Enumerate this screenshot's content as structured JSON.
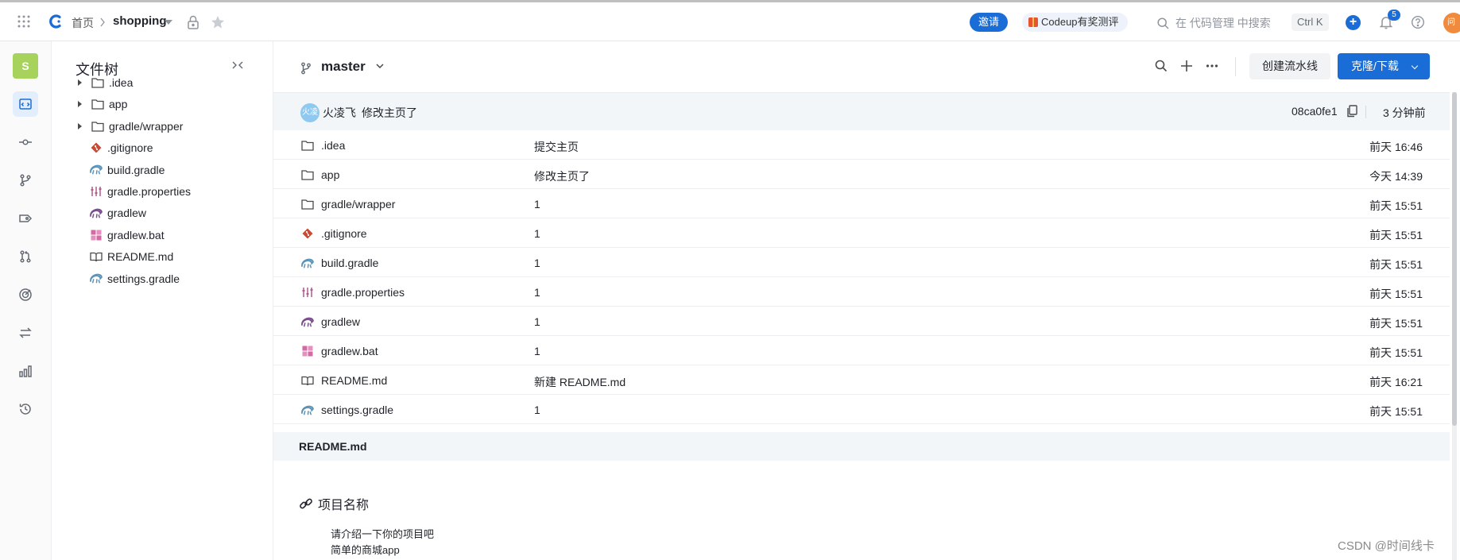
{
  "topbar": {
    "home": "首页",
    "repo": "shopping",
    "invite": "邀请",
    "promo": "Codeup有奖测评",
    "search_placeholder": "在 代码管理 中搜索",
    "shortcut": "Ctrl K",
    "notification_count": "5",
    "avatar_text": "问"
  },
  "rail": {
    "project_badge": "S",
    "items": [
      "code-icon",
      "commit-icon",
      "branch-icon",
      "tag-icon",
      "merge-request-icon",
      "review-icon",
      "compare-icon",
      "stats-icon",
      "history-icon"
    ]
  },
  "tree": {
    "title": "文件树",
    "collapse": "><",
    "items": [
      {
        "name": ".idea",
        "type": "folder"
      },
      {
        "name": "app",
        "type": "folder"
      },
      {
        "name": "gradle/wrapper",
        "type": "folder"
      },
      {
        "name": ".gitignore",
        "type": "git"
      },
      {
        "name": "build.gradle",
        "type": "gradle"
      },
      {
        "name": "gradle.properties",
        "type": "properties"
      },
      {
        "name": "gradlew",
        "type": "gradlew"
      },
      {
        "name": "gradlew.bat",
        "type": "windows"
      },
      {
        "name": "README.md",
        "type": "book"
      },
      {
        "name": "settings.gradle",
        "type": "gradle"
      }
    ]
  },
  "main": {
    "branch": "master",
    "create_pipeline": "创建流水线",
    "clone": "克隆/下载",
    "commit": {
      "avatar": "火凌",
      "author": "火凌飞",
      "message": "修改主页了",
      "sha": "08ca0fe1",
      "time": "3 分钟前"
    },
    "files": [
      {
        "name": ".idea",
        "type": "folder",
        "msg": "提交主页",
        "time": "前天 16:46"
      },
      {
        "name": "app",
        "type": "folder",
        "msg": "修改主页了",
        "time": "今天 14:39"
      },
      {
        "name": "gradle/wrapper",
        "type": "folder",
        "msg": "1",
        "time": "前天 15:51"
      },
      {
        "name": ".gitignore",
        "type": "git",
        "msg": "1",
        "time": "前天 15:51"
      },
      {
        "name": "build.gradle",
        "type": "gradle",
        "msg": "1",
        "time": "前天 15:51"
      },
      {
        "name": "gradle.properties",
        "type": "properties",
        "msg": "1",
        "time": "前天 15:51"
      },
      {
        "name": "gradlew",
        "type": "gradlew",
        "msg": "1",
        "time": "前天 15:51"
      },
      {
        "name": "gradlew.bat",
        "type": "windows",
        "msg": "1",
        "time": "前天 15:51"
      },
      {
        "name": "README.md",
        "type": "book",
        "msg": "新建 README.md",
        "time": "前天 16:21"
      },
      {
        "name": "settings.gradle",
        "type": "gradle",
        "msg": "1",
        "time": "前天 15:51"
      }
    ],
    "readme": {
      "label": "README.md",
      "heading": "项目名称",
      "lines": [
        "请介绍一下你的项目吧",
        "简单的商城app"
      ]
    }
  },
  "watermark": "CSDN @时间线卡",
  "colors": {
    "accent": "#1a6dd6",
    "project_badge": "#a7d25c",
    "commit_bar": "#f3f6f9"
  }
}
